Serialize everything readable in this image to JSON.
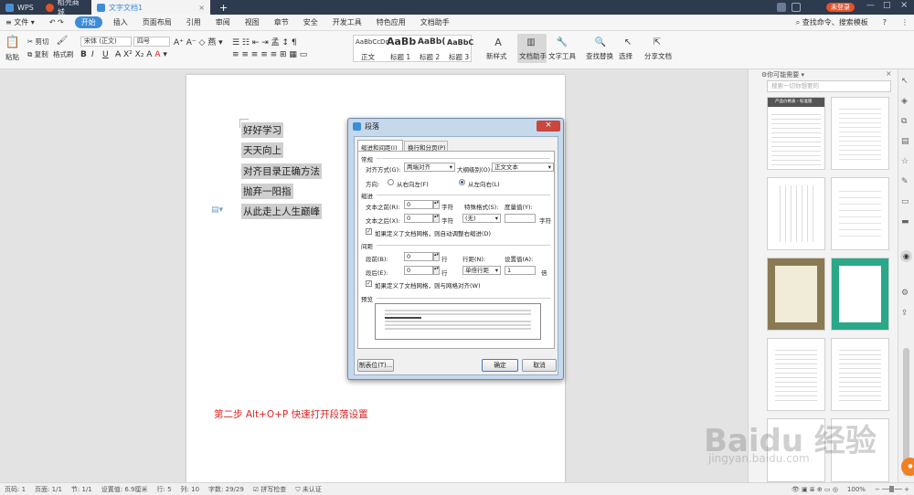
{
  "titlebar": {
    "tabs": [
      {
        "label": "WPS",
        "color": "#4b8fd1"
      },
      {
        "label": "稻壳商城",
        "color": "#e2532d"
      },
      {
        "label": "文字文档1",
        "color": "#3d8cd8"
      }
    ],
    "new_tab": "+",
    "login": "未登录"
  },
  "menubar": {
    "file": "文件",
    "items": [
      "开始",
      "插入",
      "页面布局",
      "引用",
      "审阅",
      "视图",
      "章节",
      "安全",
      "开发工具",
      "特色应用",
      "文档助手"
    ],
    "search": "查找命令、搜索模板",
    "help": "?"
  },
  "ribbon": {
    "paste": "粘贴",
    "cut": "剪切",
    "copy": "复制",
    "format_painter": "格式刷",
    "font_name": "宋体 (正文)",
    "font_size": "四号",
    "styles": [
      {
        "preview": "AaBbCcDd",
        "name": "正文"
      },
      {
        "preview": "AaBb",
        "name": "标题 1"
      },
      {
        "preview": "AaBb(",
        "name": "标题 2"
      },
      {
        "preview": "AaBbC",
        "name": "标题 3"
      }
    ],
    "new_style": "新样式",
    "doc_helper": "文档助手",
    "text_tools": "文字工具",
    "find_replace": "查找替换",
    "select": "选择",
    "share": "分享文档"
  },
  "document": {
    "lines": [
      "好好学习",
      "天天向上",
      "对齐目录正确方法",
      "抛弃一阳指",
      "从此走上人生巅峰"
    ],
    "step_note": "第二步  Alt+O+P   快速打开段落设置"
  },
  "dialog": {
    "title": "段落",
    "tabs": [
      "缩进和间距(I)",
      "换行和分页(P)"
    ],
    "general": {
      "heading": "常规",
      "align_label": "对齐方式(G):",
      "align_value": "两端对齐",
      "outline_label": "大纲级别(O):",
      "outline_value": "正文文本",
      "direction_label": "方向:",
      "rtl": "从右向左(F)",
      "ltr": "从左向右(L)"
    },
    "indent": {
      "heading": "缩进",
      "before_label": "文本之前(R):",
      "before_value": "0",
      "after_label": "文本之后(X):",
      "after_value": "0",
      "unit": "字符",
      "special_label": "特殊格式(S):",
      "special_value": "(无)",
      "measure_label": "度量值(Y):",
      "measure_unit": "字符",
      "auto_adjust": "如果定义了文档网格，则自动调整右缩进(D)"
    },
    "spacing": {
      "heading": "间距",
      "before_label": "段前(B):",
      "before_value": "0",
      "after_label": "段后(E):",
      "after_value": "0",
      "unit": "行",
      "line_label": "行距(N):",
      "line_value": "单倍行距",
      "set_label": "设置值(A):",
      "set_value": "1",
      "set_unit": "倍",
      "snap_grid": "如果定义了文档网格，则与网格对齐(W)"
    },
    "preview_heading": "预览",
    "tabs_button": "制表位(T)...",
    "ok": "确定",
    "cancel": "取消"
  },
  "right_panel": {
    "title": "你可能需要",
    "search_placeholder": "搜索一切你想要的",
    "thumb1_title": "产品价格表 - 标准版"
  },
  "status": {
    "page": "页码: 1",
    "pages": "页面: 1/1",
    "section": "节: 1/1",
    "setting": "设置值: 6.9厘米",
    "row": "行: 5",
    "col": "列: 10",
    "words": "字数: 29/29",
    "spell": "拼写检查",
    "cert": "未认证",
    "zoom": "100%"
  },
  "watermark": {
    "text": "Baidu 经验",
    "sub": "jingyan.baidu.com"
  },
  "colors": {
    "accent": "#3d8cd8",
    "titlebar": "#2e3a4d",
    "note_red": "#e02323",
    "dialog_frame": "#c5d8ec"
  }
}
